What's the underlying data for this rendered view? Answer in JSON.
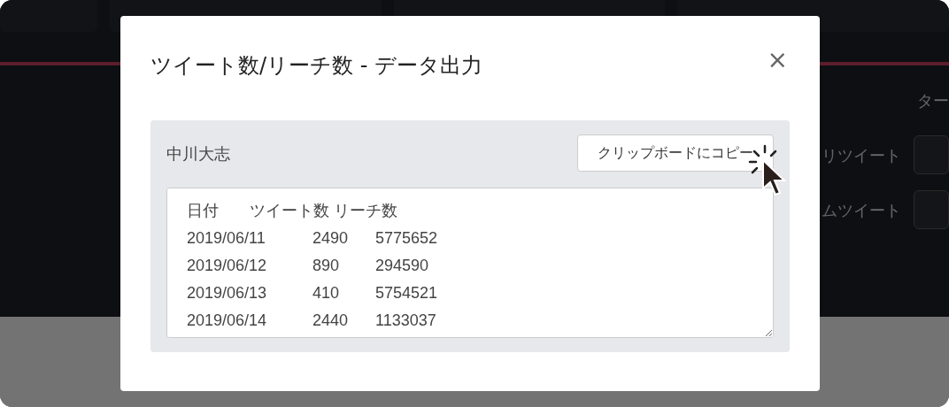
{
  "background": {
    "side_labels": [
      "ター",
      "リツイート",
      "ムツイート"
    ]
  },
  "modal": {
    "title": "ツイート数/リーチ数 - データ出力",
    "close": "×",
    "panel": {
      "name": "中川大志",
      "copy_button": "クリップボードにコピー",
      "output": "日付\tツイート数 リーチ数\n2019/06/11\t2490\t5775652\n2019/06/12\t890\t294590\n2019/06/13\t410\t5754521\n2019/06/14\t2440\t1133037"
    }
  }
}
